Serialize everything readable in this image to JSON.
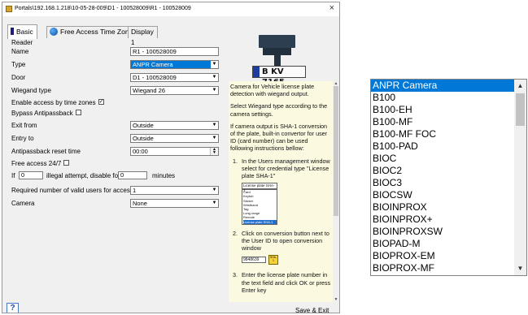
{
  "window": {
    "title": "Portals\\192.168.1.218\\10-05-28-009\\D1 - 100528009\\R1 - 100528009",
    "close": "×"
  },
  "tabs": [
    "Basic",
    "Free Access Time Zones",
    "Display"
  ],
  "form": {
    "reader_label": "Reader",
    "reader_value": "1",
    "name_label": "Name",
    "name_value": "R1 - 100528009",
    "type_label": "Type",
    "type_value": "ANPR Camera",
    "door_label": "Door",
    "door_value": "D1 - 100528009",
    "wiegand_label": "Wiegand type",
    "wiegand_value": "Wiegand 26",
    "enable_tz_label": "Enable access by time zones",
    "enable_tz_checked": true,
    "bypass_label": "Bypass Antipassback",
    "bypass_checked": false,
    "exit_from_label": "Exit from",
    "exit_from_value": "Outside",
    "entry_to_label": "Entry to",
    "entry_to_value": "Outside",
    "apb_reset_label": "Antipassback reset time",
    "apb_reset_value": "00:00",
    "free_access_label": "Free access 24/7",
    "free_access_checked": false,
    "if_label": "If",
    "if_value": "0",
    "illegal_label": "illegal attempt, disable for",
    "disable_value": "0",
    "minutes_label": "minutes",
    "required_label": "Required number of valid users for access",
    "required_value": "1",
    "camera_label": "Camera",
    "camera_value": "None"
  },
  "plate": {
    "text": "B KV 7165"
  },
  "help": {
    "p1": "Camera for Vehicle license plate detection with wiegand output.",
    "p2": "Select Wiegand type according to the camera settings.",
    "p3": "If camera output is SHA-1 conversion of the plate, built-in convertor for user ID (card number) can be used following instructions bellow:",
    "step1_num": "1.",
    "step1": "In the Users management window select for credential type \"License plate SHA-1\"",
    "mini_combo": "License plate SHA-1",
    "mini_list": [
      "Card",
      "Keyfob",
      "Sticker",
      "Wristband",
      "Tag",
      "Long range",
      "Remote",
      "License plate SHA-1"
    ],
    "step2_num": "2.",
    "step2": "Click on conversion button next to the User ID to open conversion window",
    "conv_value": "9848639",
    "conv_button": "SHA-1",
    "step3_num": "3.",
    "step3": "Enter the license plate number in the text field and click OK or press Enter key"
  },
  "buttons": {
    "help": "?",
    "save": "Save & Exit"
  },
  "type_list": [
    "ANPR Camera",
    "B100",
    "B100-EH",
    "B100-MF",
    "B100-MF FOC",
    "B100-PAD",
    "BIOC",
    "BIOC2",
    "BIOC3",
    "BIOCSW",
    "BIOINPROX",
    "BIOINPROX+",
    "BIOINPROXSW",
    "BIOPAD-M",
    "BIOPROX-EM",
    "BIOPROX-MF"
  ],
  "colors": {
    "selection": "#0078d7",
    "help_bg": "#fbf9e0",
    "panel_bg": "#f0f0f0"
  }
}
